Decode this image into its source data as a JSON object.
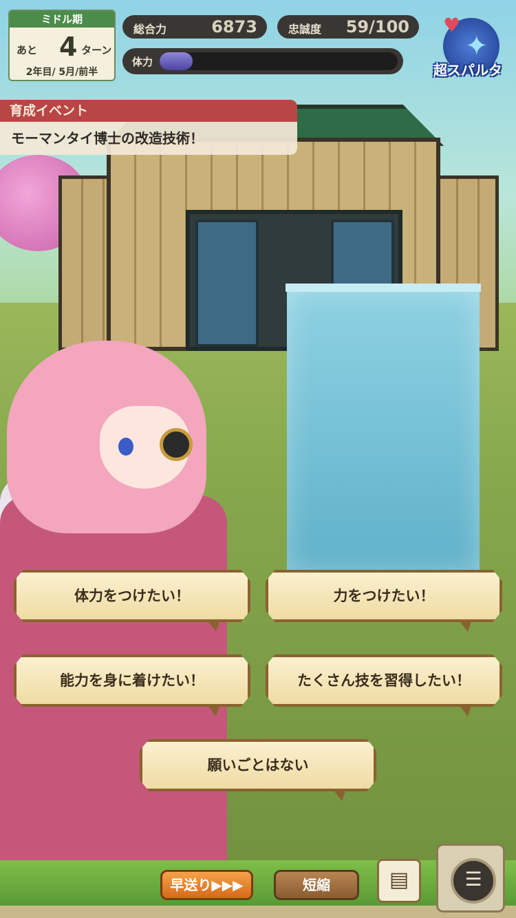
{
  "turn": {
    "phase": "ミドル期",
    "prefix": "あと",
    "remaining": "4",
    "suffix": "ターン",
    "date": "2年目/ 5月/前半"
  },
  "stats": {
    "total_power_label": "総合力",
    "total_power_value": "6873",
    "loyalty_label": "忠誠度",
    "loyalty_value": "59/100",
    "stamina_label": "体力",
    "stamina_fraction": 0.14
  },
  "mode": {
    "label": "超スパルタ",
    "icon": "shuriken-heart-icon",
    "colors": {
      "ring": "#2a52b5",
      "text_outline": "#1f3e8f"
    }
  },
  "event": {
    "header": "育成イベント",
    "title": "モーマンタイ博士の改造技術！"
  },
  "choices": [
    {
      "label": "体力をつけたい！"
    },
    {
      "label": "力をつけたい！"
    },
    {
      "label": "能力を身に着けたい！"
    },
    {
      "label": "たくさん技を習得したい！"
    },
    {
      "label": "願いごとはない"
    }
  ],
  "controls": {
    "fast_forward": "早送り▶▶▶",
    "shorten": "短縮",
    "log_icon": "document-log-icon",
    "menu_icon": "menu-hamburger-icon"
  },
  "colors": {
    "event_header": "#b84646",
    "choice_border": "#8a6230",
    "stamina_bar": "#4d43a3",
    "fast_forward": "#e07a22"
  }
}
